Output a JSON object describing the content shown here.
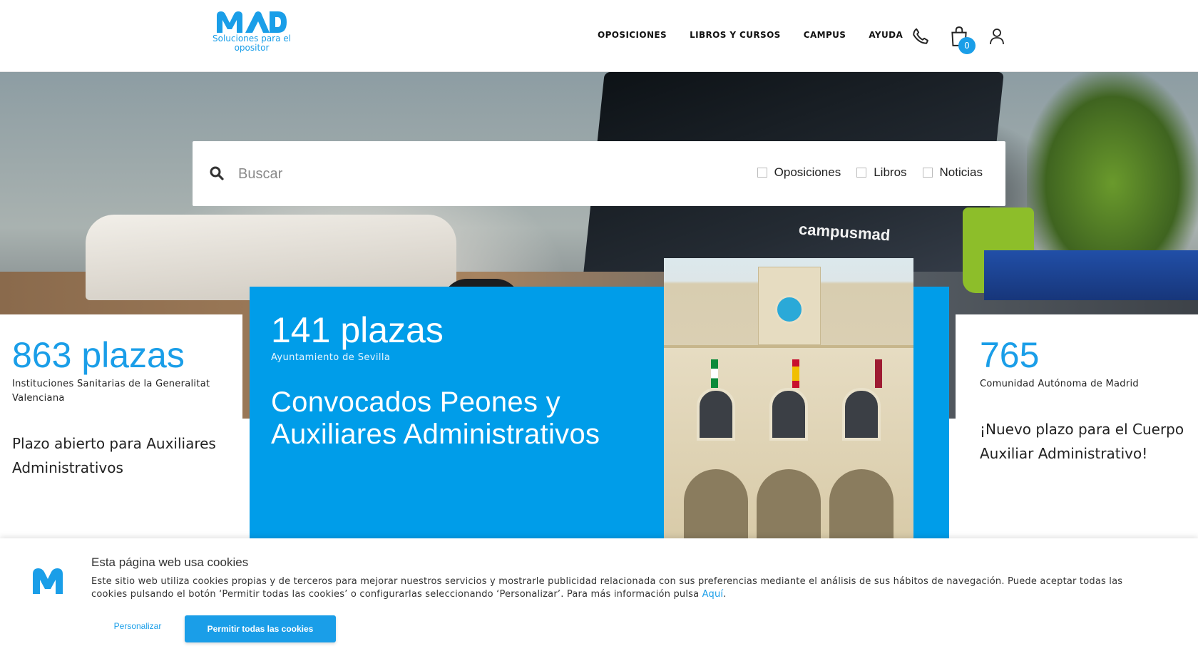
{
  "header": {
    "logo_alt": "MAD",
    "tagline": "Soluciones para el opositor",
    "nav": [
      {
        "label": "OPOSICIONES"
      },
      {
        "label": "LIBROS Y CURSOS"
      },
      {
        "label": "CAMPUS"
      },
      {
        "label": "AYUDA"
      }
    ],
    "cart_count": "0"
  },
  "hero": {
    "laptop_brand": "campusmad"
  },
  "search": {
    "placeholder": "Buscar",
    "filters": [
      {
        "label": "Oposiciones",
        "checked": false
      },
      {
        "label": "Libros",
        "checked": false
      },
      {
        "label": "Noticias",
        "checked": false
      }
    ]
  },
  "cards": {
    "left": {
      "number": "863 plazas",
      "org": "Instituciones Sanitarias de la Generalitat Valenciana",
      "description": "Plazo abierto para Auxiliares Administrativos"
    },
    "main": {
      "number": "141 plazas",
      "org": "Ayuntamiento de Sevilla",
      "title": "Convocados Peones y Auxiliares Administrativos"
    },
    "right": {
      "number": "765",
      "org": "Comunidad Autónoma de Madrid",
      "description": "¡Nuevo plazo para el Cuerpo Auxiliar Administrativo!"
    }
  },
  "cookie": {
    "title": "Esta página web usa cookies",
    "text": "Este sitio web utiliza cookies propias y de terceros para mejorar nuestros servicios y mostrarle publicidad relacionada con sus preferencias mediante el análisis de sus hábitos de navegación. Puede aceptar todas las cookies pulsando el botón ‘Permitir todas las cookies’ o configurarlas seleccionando ‘Personalizar’. Para más información pulsa",
    "link": "Aquí",
    "personalize_label": "Personalizar",
    "accept_label": "Permitir todas las cookies"
  },
  "colors": {
    "brand": "#1a9ee8",
    "card_blue": "#009de9"
  }
}
